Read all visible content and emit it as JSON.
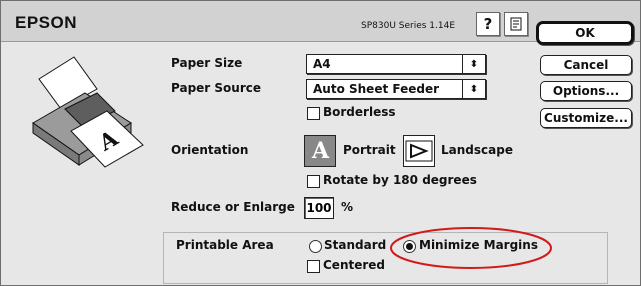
{
  "header": {
    "brand": "EPSON",
    "model": "SP830U Series 1.14E",
    "help_icon_glyph": "?",
    "settings_icon_glyph": "⚙"
  },
  "buttons": {
    "ok": "OK",
    "cancel": "Cancel",
    "options": "Options...",
    "customize": "Customize..."
  },
  "form": {
    "paper_size": {
      "label": "Paper Size",
      "value": "A4"
    },
    "paper_source": {
      "label": "Paper Source",
      "value": "Auto Sheet Feeder"
    },
    "borderless": {
      "label": "Borderless",
      "checked": false
    },
    "orientation": {
      "label": "Orientation",
      "portrait": "Portrait",
      "landscape": "Landscape",
      "selected": "Portrait",
      "portrait_glyph": "A"
    },
    "rotate": {
      "label": "Rotate by 180 degrees",
      "checked": false
    },
    "reduce": {
      "label": "Reduce or Enlarge",
      "value": "100",
      "unit": "%"
    },
    "printable_area": {
      "label": "Printable Area",
      "standard": "Standard",
      "minimize": "Minimize Margins",
      "selected": "Minimize Margins",
      "centered": "Centered",
      "centered_checked": false
    }
  },
  "printer_illustration_glyph": "A",
  "colors": {
    "highlight": "#d11a1a",
    "window_bg": "#e7e7e7"
  }
}
